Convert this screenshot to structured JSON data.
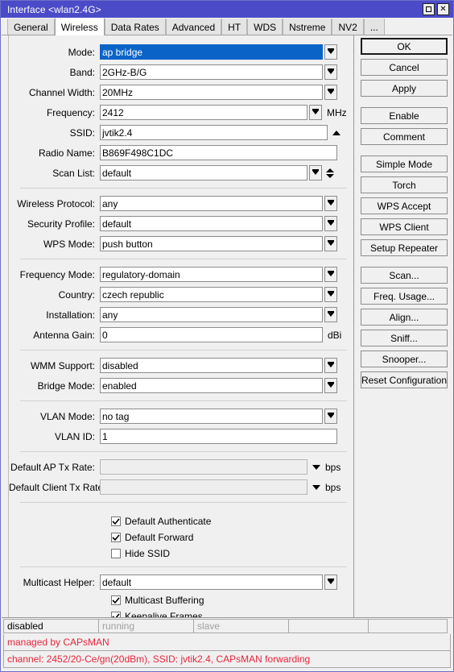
{
  "window": {
    "title": "Interface <wlan2.4G>",
    "titlebar_color": "#4b4bc8",
    "buttons": [
      {
        "name": "maximize-button",
        "glyph": "□"
      },
      {
        "name": "close-button",
        "glyph": "✕"
      }
    ]
  },
  "tabs": [
    {
      "label": "General",
      "active": false
    },
    {
      "label": "Wireless",
      "active": true
    },
    {
      "label": "Data Rates",
      "active": false
    },
    {
      "label": "Advanced",
      "active": false
    },
    {
      "label": "HT",
      "active": false
    },
    {
      "label": "WDS",
      "active": false
    },
    {
      "label": "Nstreme",
      "active": false
    },
    {
      "label": "NV2",
      "active": false
    },
    {
      "label": "...",
      "active": false
    }
  ],
  "form": {
    "mode": {
      "label": "Mode:",
      "value": "ap bridge"
    },
    "band": {
      "label": "Band:",
      "value": "2GHz-B/G"
    },
    "channel_width": {
      "label": "Channel Width:",
      "value": "20MHz"
    },
    "frequency": {
      "label": "Frequency:",
      "value": "2412",
      "unit": "MHz"
    },
    "ssid": {
      "label": "SSID:",
      "value": "jvtik2.4"
    },
    "radio_name": {
      "label": "Radio Name:",
      "value": "B869F498C1DC"
    },
    "scan_list": {
      "label": "Scan List:",
      "value": "default"
    },
    "wireless_protocol": {
      "label": "Wireless Protocol:",
      "value": "any"
    },
    "security_profile": {
      "label": "Security Profile:",
      "value": "default"
    },
    "wps_mode": {
      "label": "WPS Mode:",
      "value": "push button"
    },
    "frequency_mode": {
      "label": "Frequency Mode:",
      "value": "regulatory-domain"
    },
    "country": {
      "label": "Country:",
      "value": "czech republic"
    },
    "installation": {
      "label": "Installation:",
      "value": "any"
    },
    "antenna_gain": {
      "label": "Antenna Gain:",
      "value": "0",
      "unit": "dBi"
    },
    "wmm_support": {
      "label": "WMM Support:",
      "value": "disabled"
    },
    "bridge_mode": {
      "label": "Bridge Mode:",
      "value": "enabled"
    },
    "vlan_mode": {
      "label": "VLAN Mode:",
      "value": "no tag"
    },
    "vlan_id": {
      "label": "VLAN ID:",
      "value": "1"
    },
    "default_ap_tx_rate": {
      "label": "Default AP Tx Rate:",
      "value": "",
      "unit": "bps"
    },
    "default_client_tx_rate": {
      "label": "Default Client Tx Rate:",
      "value": "",
      "unit": "bps"
    },
    "multicast_helper": {
      "label": "Multicast Helper:",
      "value": "default"
    },
    "checkboxes": [
      {
        "label": "Default Authenticate",
        "checked": true
      },
      {
        "label": "Default Forward",
        "checked": true
      },
      {
        "label": "Hide SSID",
        "checked": false
      }
    ],
    "checkboxes2": [
      {
        "label": "Multicast Buffering",
        "checked": true
      },
      {
        "label": "Keepalive Frames",
        "checked": true
      }
    ]
  },
  "buttons": [
    {
      "label": "OK",
      "default": true
    },
    {
      "label": "Cancel",
      "default": false
    },
    {
      "label": "Apply",
      "default": false
    },
    {
      "label": "Enable",
      "default": false
    },
    {
      "label": "Comment",
      "default": false
    },
    {
      "label": "Simple Mode",
      "default": false
    },
    {
      "label": "Torch",
      "default": false
    },
    {
      "label": "WPS Accept",
      "default": false
    },
    {
      "label": "WPS Client",
      "default": false
    },
    {
      "label": "Setup Repeater",
      "default": false
    },
    {
      "label": "Scan...",
      "default": false
    },
    {
      "label": "Freq. Usage...",
      "default": false
    },
    {
      "label": "Align...",
      "default": false
    },
    {
      "label": "Sniff...",
      "default": false
    },
    {
      "label": "Snooper...",
      "default": false
    },
    {
      "label": "Reset Configuration",
      "default": false
    }
  ],
  "status": {
    "cells": [
      {
        "text": "disabled",
        "dim": false
      },
      {
        "text": "running",
        "dim": true
      },
      {
        "text": "slave",
        "dim": true
      },
      {
        "text": "",
        "dim": false
      },
      {
        "text": "",
        "dim": false
      }
    ],
    "line1": "managed by CAPsMAN",
    "line2": "channel: 2452/20-Ce/gn(20dBm), SSID: jvtik2.4, CAPsMAN forwarding",
    "message_color": "#e8253c"
  }
}
